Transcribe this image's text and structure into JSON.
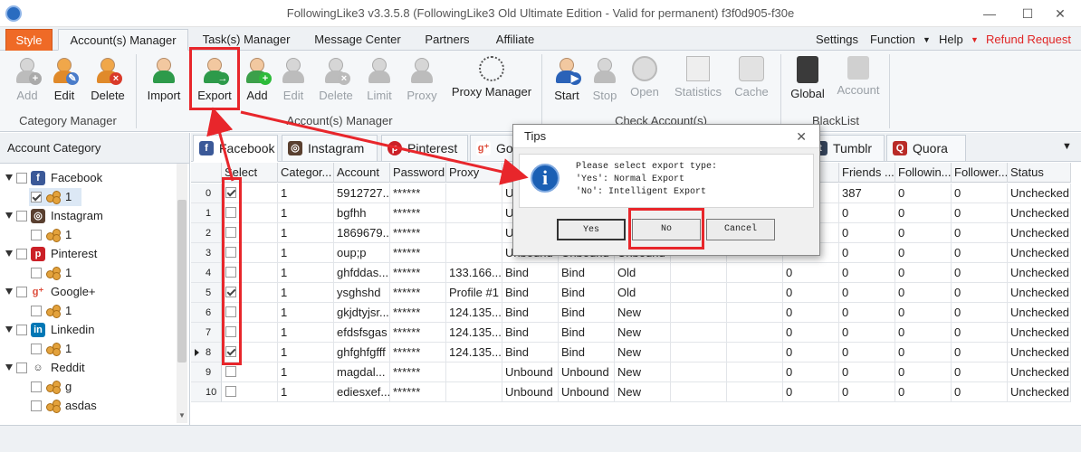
{
  "window": {
    "title": "FollowingLike3 v3.3.5.8 (FollowingLike3 Old Ultimate Edition - Valid for permanent) f3f0d905-f30e",
    "min": "—",
    "max": "☐",
    "close": "✕"
  },
  "menu_tabs": [
    "Style",
    "Account(s) Manager",
    "Task(s) Manager",
    "Message Center",
    "Partners",
    "Affiliate"
  ],
  "right_menu": {
    "settings": "Settings",
    "function": "Function",
    "help": "Help",
    "refund": "Refund Request"
  },
  "ribbon": {
    "category": {
      "label": "Category Manager",
      "buttons": [
        "Add",
        "Edit",
        "Delete"
      ]
    },
    "accounts": {
      "label": "Account(s) Manager",
      "buttons": [
        "Import",
        "Export",
        "Add",
        "Edit",
        "Delete",
        "Limit",
        "Proxy",
        "Proxy Manager"
      ]
    },
    "check": {
      "label": "Check Account(s)",
      "buttons": [
        "Start",
        "Stop",
        "Open",
        "Statistics",
        "Cache"
      ]
    },
    "blacklist": {
      "label": "BlackList",
      "buttons": [
        "Global",
        "Account"
      ]
    }
  },
  "left_panel": {
    "title": "Account Category",
    "tree": [
      {
        "name": "Facebook",
        "icon": "facebook-icon",
        "children": [
          "1"
        ]
      },
      {
        "name": "Instagram",
        "icon": "instagram-icon",
        "children": [
          "1"
        ]
      },
      {
        "name": "Pinterest",
        "icon": "pinterest-icon",
        "children": [
          "1"
        ]
      },
      {
        "name": "Google+",
        "icon": "googleplus-icon",
        "children": [
          "1"
        ]
      },
      {
        "name": "Linkedin",
        "icon": "linkedin-icon",
        "children": [
          "1"
        ]
      },
      {
        "name": "Reddit",
        "icon": "reddit-icon",
        "children": [
          "g",
          "asdas"
        ]
      }
    ]
  },
  "social_tabs": [
    "Facebook",
    "Instagram",
    "Pinterest",
    "Go",
    "Tumblr",
    "Quora"
  ],
  "table": {
    "columns": [
      "Select",
      "Categor...",
      "Account",
      "Password",
      "Proxy",
      "",
      "",
      "",
      "",
      "",
      "m...",
      "Friends ...",
      "Followin...",
      "Follower...",
      "Status"
    ],
    "rows": [
      {
        "idx": "0",
        "sel": true,
        "cat": "1",
        "account": "5912727...",
        "pwd": "******",
        "proxy": "",
        "c5": "U",
        "c6": "",
        "c7": "",
        "c8": "",
        "c9": "",
        "c10": "",
        "friends": "387",
        "following": "0",
        "followers": "0",
        "status": "Unchecked"
      },
      {
        "idx": "1",
        "sel": false,
        "cat": "1",
        "account": "bgfhh",
        "pwd": "******",
        "proxy": "",
        "c5": "U",
        "c6": "",
        "c7": "",
        "c8": "",
        "c9": "",
        "c10": "",
        "friends": "0",
        "following": "0",
        "followers": "0",
        "status": "Unchecked"
      },
      {
        "idx": "2",
        "sel": false,
        "cat": "1",
        "account": "1869679...",
        "pwd": "******",
        "proxy": "",
        "c5": "U",
        "c6": "",
        "c7": "",
        "c8": "",
        "c9": "",
        "c10": "",
        "friends": "0",
        "following": "0",
        "followers": "0",
        "status": "Unchecked"
      },
      {
        "idx": "3",
        "sel": false,
        "cat": "1",
        "account": "oup;p",
        "pwd": "******",
        "proxy": "",
        "c5": "Unbound",
        "c6": "Unbound",
        "c7": "Unbound",
        "c8": "",
        "c9": "",
        "c10": "",
        "friends": "0",
        "following": "0",
        "followers": "0",
        "status": "Unchecked"
      },
      {
        "idx": "4",
        "sel": false,
        "cat": "1",
        "account": "ghfddas...",
        "pwd": "******",
        "proxy": "133.166....",
        "c5": "Bind",
        "c6": "Bind",
        "c7": "Old",
        "c8": "",
        "c9": "",
        "c10": "0",
        "friends": "0",
        "following": "0",
        "followers": "0",
        "status": "Unchecked"
      },
      {
        "idx": "5",
        "sel": true,
        "cat": "1",
        "account": "ysghshd",
        "pwd": "******",
        "proxy": "Profile #1",
        "c5": "Bind",
        "c6": "Bind",
        "c7": "Old",
        "c8": "",
        "c9": "",
        "c10": "0",
        "friends": "0",
        "following": "0",
        "followers": "0",
        "status": "Unchecked"
      },
      {
        "idx": "6",
        "sel": false,
        "cat": "1",
        "account": "gkjdtyjsr...",
        "pwd": "******",
        "proxy": "124.135....",
        "c5": "Bind",
        "c6": "Bind",
        "c7": "New",
        "c8": "",
        "c9": "",
        "c10": "0",
        "friends": "0",
        "following": "0",
        "followers": "0",
        "status": "Unchecked"
      },
      {
        "idx": "7",
        "sel": false,
        "cat": "1",
        "account": "efdsfsgas",
        "pwd": "******",
        "proxy": "124.135....",
        "c5": "Bind",
        "c6": "Bind",
        "c7": "New",
        "c8": "",
        "c9": "",
        "c10": "0",
        "friends": "0",
        "following": "0",
        "followers": "0",
        "status": "Unchecked"
      },
      {
        "idx": "8",
        "sel": true,
        "cat": "1",
        "account": "ghfghfgfff",
        "pwd": "******",
        "proxy": "124.135....",
        "c5": "Bind",
        "c6": "Bind",
        "c7": "New",
        "c8": "",
        "c9": "",
        "c10": "0",
        "friends": "0",
        "following": "0",
        "followers": "0",
        "status": "Unchecked"
      },
      {
        "idx": "9",
        "sel": false,
        "cat": "1",
        "account": "magdal...",
        "pwd": "******",
        "proxy": "",
        "c5": "Unbound",
        "c6": "Unbound",
        "c7": "New",
        "c8": "",
        "c9": "",
        "c10": "0",
        "friends": "0",
        "following": "0",
        "followers": "0",
        "status": "Unchecked"
      },
      {
        "idx": "10",
        "sel": false,
        "cat": "1",
        "account": "ediesxef...",
        "pwd": "******",
        "proxy": "",
        "c5": "Unbound",
        "c6": "Unbound",
        "c7": "New",
        "c8": "",
        "c9": "",
        "c10": "0",
        "friends": "0",
        "following": "0",
        "followers": "0",
        "status": "Unchecked"
      }
    ]
  },
  "dialog": {
    "title": "Tips",
    "close": "✕",
    "icon": "i",
    "lines": [
      "Please select export type:",
      "'Yes': Normal Export",
      "'No': Intelligent Export"
    ],
    "buttons": [
      "Yes",
      "No",
      "Cancel"
    ]
  },
  "colors": {
    "accent_orange": "#ef6a26",
    "highlight_red": "#e8262b",
    "refund_red": "#e02525"
  }
}
